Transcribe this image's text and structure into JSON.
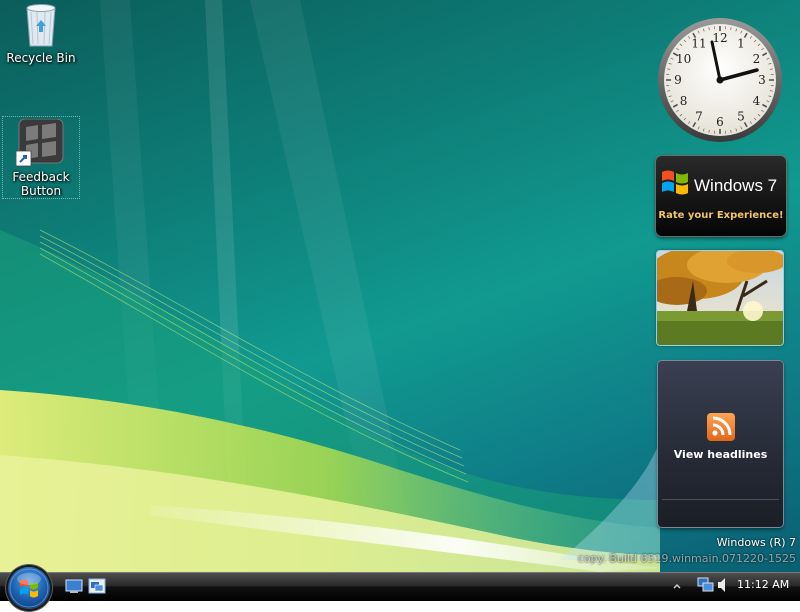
{
  "desktop": {
    "icons": [
      {
        "label": "Recycle Bin",
        "icon": "recycle-bin-icon"
      },
      {
        "label": "Feedback\nButton",
        "icon": "feedback-button-icon"
      }
    ]
  },
  "gadgets": {
    "clock": {
      "numerals": [
        "12",
        "1",
        "2",
        "3",
        "4",
        "5",
        "6",
        "7",
        "8",
        "9",
        "10",
        "11"
      ],
      "time_shown": "2:57"
    },
    "windows7": {
      "title": "Windows 7",
      "tagline": "Rate your Experience!"
    },
    "slideshow": {
      "icon": "autumn-tree-photo"
    },
    "feed": {
      "label": "View headlines",
      "icon": "rss-icon"
    }
  },
  "watermark": {
    "line1": "Windows (R) 7",
    "line2": "copy. Build 6519.winmain.071220-1525"
  },
  "taskbar": {
    "start_icon": "windows-start-orb",
    "quick_launch": [
      "show-desktop-icon",
      "switch-windows-icon"
    ],
    "tray": {
      "icons": [
        "show-hidden-icons-chevron",
        "network-icon",
        "volume-icon"
      ],
      "time": "11:12 AM"
    }
  },
  "colors": {
    "wallpaper_teal": "#0e7d77",
    "wallpaper_green": "#b8e04a",
    "win7_rate": "#f1c36b",
    "rss_orange": "#f08a2a"
  }
}
